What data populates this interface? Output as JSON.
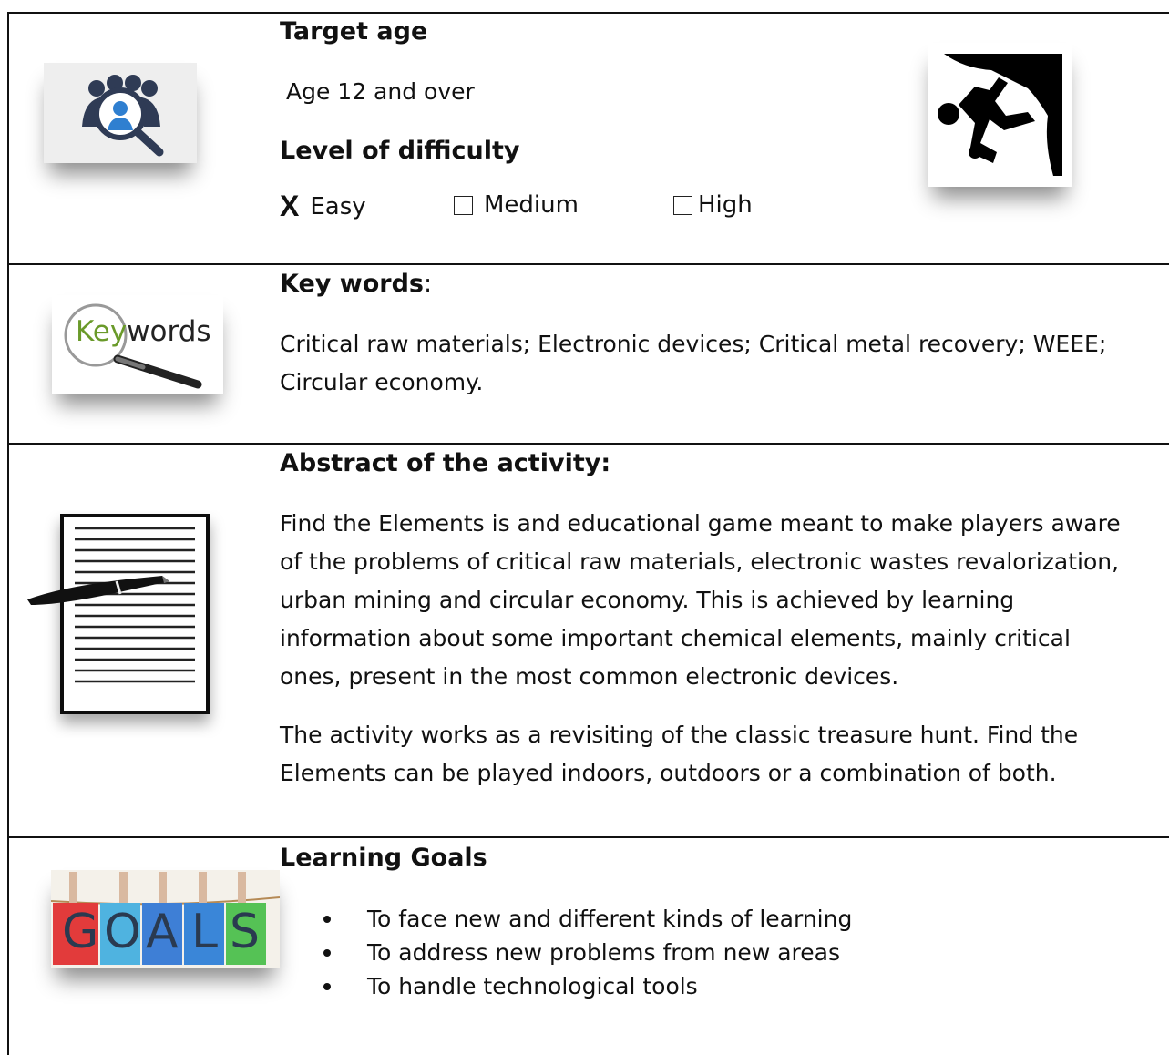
{
  "target_age": {
    "heading": "Target age",
    "value": "Age 12 and over"
  },
  "difficulty": {
    "heading": "Level of difficulty",
    "options": [
      {
        "mark": "X",
        "label": "Easy",
        "checked": true
      },
      {
        "label": "Medium",
        "checked": false
      },
      {
        "label": "High",
        "checked": false
      }
    ]
  },
  "keywords": {
    "heading": "Key words",
    "colon": ":",
    "line1": "Critical raw materials; Electronic devices; Critical metal recovery; WEEE;",
    "line2": "Circular economy.",
    "logo": {
      "key": "Key",
      "words": "words"
    }
  },
  "abstract": {
    "heading": "Abstract of the activity:",
    "para1": [
      "Find the Elements is and educational game meant to make players aware",
      "of the problems of critical raw materials, electronic wastes revalorization,",
      "urban mining and circular economy. This is achieved by learning",
      "information about some important chemical elements, mainly critical",
      "ones, present in the most common electronic devices."
    ],
    "para2": [
      "The activity works as a revisiting of the classic treasure hunt. Find the",
      "Elements can be played indoors, outdoors or a combination of both."
    ]
  },
  "learning_goals": {
    "heading": "Learning Goals",
    "items": [
      "To face new and different kinds of learning",
      "To address new problems from new areas",
      "To handle technological tools"
    ],
    "goals_letters": [
      "G",
      "O",
      "A",
      "L",
      "S"
    ],
    "goals_colors": [
      "#e23b3b",
      "#4fb3e0",
      "#3e7fd6",
      "#3a86d8",
      "#55c255"
    ]
  },
  "icons": [
    "audience-search-icon",
    "climber-icon",
    "keywords-magnifier-icon",
    "document-pen-icon",
    "goals-cards-icon"
  ]
}
